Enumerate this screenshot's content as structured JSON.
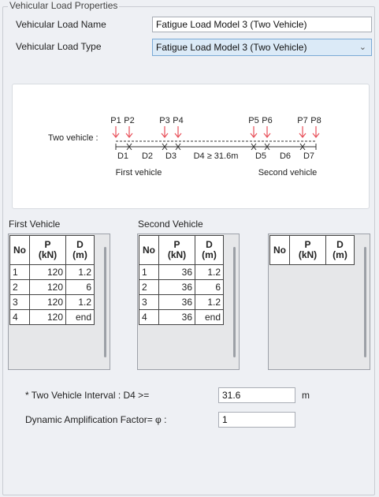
{
  "group": {
    "title": "Vehicular Load Properties"
  },
  "form": {
    "name_label": "Vehicular Load Name",
    "name_value": "Fatigue Load Model 3 (Two Vehicle)",
    "type_label": "Vehicular Load Type",
    "type_value": "Fatigue Load Model 3 (Two Vehicle)"
  },
  "diagram": {
    "row_label": "Two vehicle :",
    "loads": [
      "P1",
      "P2",
      "P3",
      "P4",
      "P5",
      "P6",
      "P7",
      "P8"
    ],
    "dims": [
      "D1",
      "D2",
      "D3",
      "D4 ≥ 31.6m",
      "D5",
      "D6",
      "D7"
    ],
    "first_vehicle": "First vehicle",
    "second_vehicle": "Second vehicle",
    "arrow_color": "#e8515a"
  },
  "tables": {
    "first_title": "First Vehicle",
    "second_title": "Second Vehicle",
    "headers": {
      "no": "No",
      "p1": "P",
      "p2": "(kN)",
      "d1": "D",
      "d2": "(m)"
    },
    "first_rows": [
      {
        "no": "1",
        "p": "120",
        "d": "1.2"
      },
      {
        "no": "2",
        "p": "120",
        "d": "6"
      },
      {
        "no": "3",
        "p": "120",
        "d": "1.2"
      },
      {
        "no": "4",
        "p": "120",
        "d": "end"
      }
    ],
    "second_rows": [
      {
        "no": "1",
        "p": "36",
        "d": "1.2"
      },
      {
        "no": "2",
        "p": "36",
        "d": "6"
      },
      {
        "no": "3",
        "p": "36",
        "d": "1.2"
      },
      {
        "no": "4",
        "p": "36",
        "d": "end"
      }
    ]
  },
  "interval": {
    "label": "* Two Vehicle Interval : D4 >=",
    "value": "31.6",
    "unit": "m"
  },
  "amplification": {
    "label": "Dynamic Amplification Factor= φ :",
    "value": "1"
  }
}
